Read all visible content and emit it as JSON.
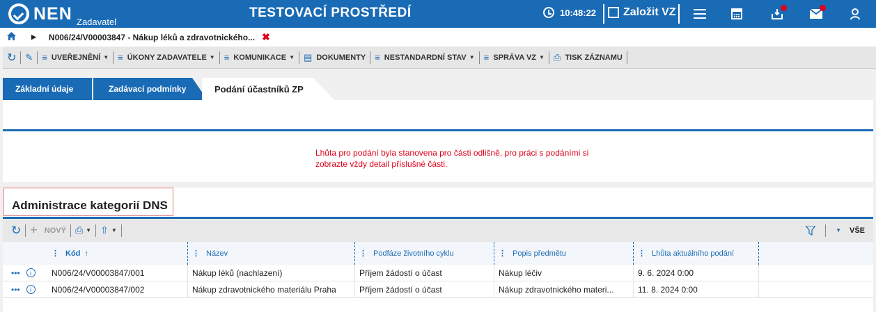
{
  "header": {
    "logo": "NEN",
    "logo_sub": "Zadavatel",
    "env_title": "TESTOVACÍ PROSTŘEDÍ",
    "time": "10:48:22",
    "create_label": "Založit VZ",
    "icons": [
      "menu-icon",
      "calculator-icon",
      "inbox-icon",
      "mail-icon",
      "user-icon"
    ]
  },
  "breadcrumb": {
    "text": "N006/24/V00003847 - Nákup léků a zdravotnického..."
  },
  "toolbar": {
    "items": [
      "UVEŘEJNĚNÍ",
      "ÚKONY ZADAVATELE",
      "KOMUNIKACE",
      "DOKUMENTY",
      "NESTANDARDNÍ STAV",
      "SPRÁVA VZ",
      "TISK ZÁZNAMU"
    ]
  },
  "tabs": [
    "Základní údaje",
    "Zadávací podmínky",
    "Podání účastníků ZP"
  ],
  "notice": {
    "line1": "Lhůta pro podání byla stanovena pro části odlišně, pro práci s podáními si",
    "line2": "zobrazte vždy detail příslušné části."
  },
  "dns": {
    "title": "Administrace kategorií DNS",
    "new_label": "NOVÝ",
    "all_label": "VŠE",
    "columns": [
      "Kód",
      "Název",
      "Podfáze životního cyklu",
      "Popis předmětu",
      "Lhůta aktuálního podání"
    ],
    "rows": [
      [
        "N006/24/V00003847/001",
        "Nákup léků (nachlazení)",
        "Příjem žádostí o účast",
        "Nákup léčiv",
        "9. 6. 2024 0:00"
      ],
      [
        "N006/24/V00003847/002",
        "Nákup zdravotnického materiálu Praha",
        "Příjem žádostí o účast",
        "Nákup zdravotnického materi...",
        "11. 8. 2024 0:00"
      ]
    ]
  },
  "colors": {
    "brand": "#1a6bb5",
    "alert": "#e0001a"
  }
}
